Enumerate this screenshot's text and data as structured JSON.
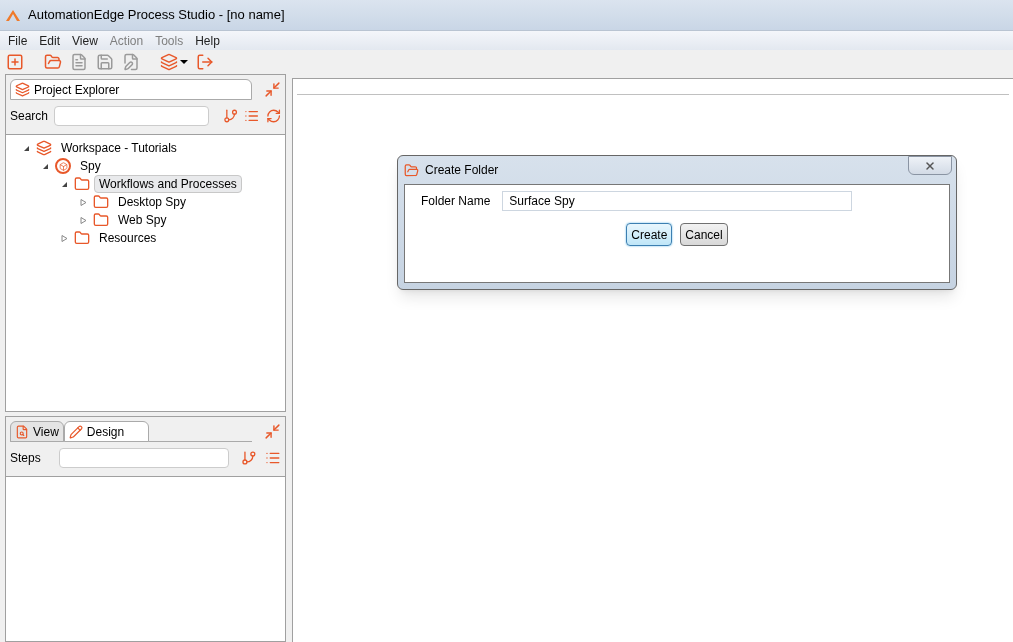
{
  "window": {
    "title": "AutomationEdge Process Studio - [no name]"
  },
  "menu": [
    {
      "label": "File",
      "disabled": false
    },
    {
      "label": "Edit",
      "disabled": false
    },
    {
      "label": "View",
      "disabled": false
    },
    {
      "label": "Action",
      "disabled": true
    },
    {
      "label": "Tools",
      "disabled": true
    },
    {
      "label": "Help",
      "disabled": false
    }
  ],
  "toolbar": [
    {
      "kind": "new",
      "disabled": false
    },
    {
      "kind": "open",
      "disabled": false
    },
    {
      "kind": "properties",
      "disabled": true
    },
    {
      "kind": "save",
      "disabled": true
    },
    {
      "kind": "save-as",
      "disabled": true
    },
    {
      "kind": "layers",
      "disabled": false
    },
    {
      "kind": "exit",
      "disabled": false
    }
  ],
  "project_explorer": {
    "tab": "Project Explorer",
    "search_label": "Search",
    "tree": [
      {
        "label": "Workspace - Tutorials",
        "kind": "workspace",
        "expanded": true,
        "selected": false,
        "children": [
          {
            "label": "Spy",
            "kind": "project",
            "expanded": true,
            "selected": false,
            "children": [
              {
                "label": "Workflows and Processes",
                "kind": "folder",
                "expanded": true,
                "selected": true,
                "children": [
                  {
                    "label": "Desktop Spy",
                    "kind": "folder",
                    "expanded": false,
                    "selected": false
                  },
                  {
                    "label": "Web Spy",
                    "kind": "folder",
                    "expanded": false,
                    "selected": false
                  }
                ]
              },
              {
                "label": "Resources",
                "kind": "folder",
                "expanded": false,
                "selected": false
              }
            ]
          }
        ]
      }
    ]
  },
  "steps_panel": {
    "tabs": [
      {
        "label": "View",
        "selected": false
      },
      {
        "label": "Design",
        "selected": true
      }
    ],
    "steps_label": "Steps"
  },
  "dialog": {
    "title": "Create Folder",
    "field_label": "Folder Name",
    "field_value": "Surface Spy",
    "buttons": [
      {
        "label": "Create",
        "default": true
      },
      {
        "label": "Cancel",
        "default": false
      }
    ]
  }
}
